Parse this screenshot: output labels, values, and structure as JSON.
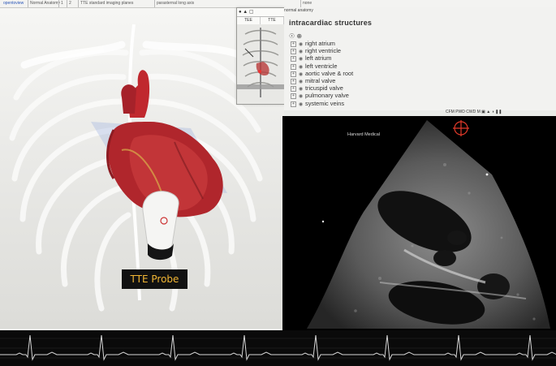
{
  "topbar": {
    "items": [
      "opentoview",
      "Normal Anatomy",
      "TTE standard imaging planes",
      "parasternal long axis",
      "none"
    ],
    "nav": [
      "1",
      "2"
    ]
  },
  "minimap": {
    "tabs": [
      "TEE",
      "TTE"
    ]
  },
  "structures_panel": {
    "header": "normal anatomy",
    "title": "intracardiac structures",
    "items": [
      {
        "label": "right atrium",
        "expandable": true
      },
      {
        "label": "right ventricle",
        "expandable": true
      },
      {
        "label": "left atrium",
        "expandable": true
      },
      {
        "label": "left ventricle",
        "expandable": true
      },
      {
        "label": "aortic valve & root",
        "expandable": true
      },
      {
        "label": "mitral valve",
        "expandable": true
      },
      {
        "label": "tricuspid valve",
        "expandable": true
      },
      {
        "label": "pulmonary valve",
        "expandable": true
      },
      {
        "label": "systemic veins",
        "expandable": true
      }
    ]
  },
  "echo": {
    "toolbar": "CFM PWD CWD M",
    "brand": "Harvard Medical",
    "target_color": "#e23a2a"
  },
  "scene": {
    "probe_label": "TTE Probe",
    "label_color": "#f2b634"
  },
  "colors": {
    "heart": "#b0262c",
    "ecg_trace": "#d8d8d8"
  }
}
